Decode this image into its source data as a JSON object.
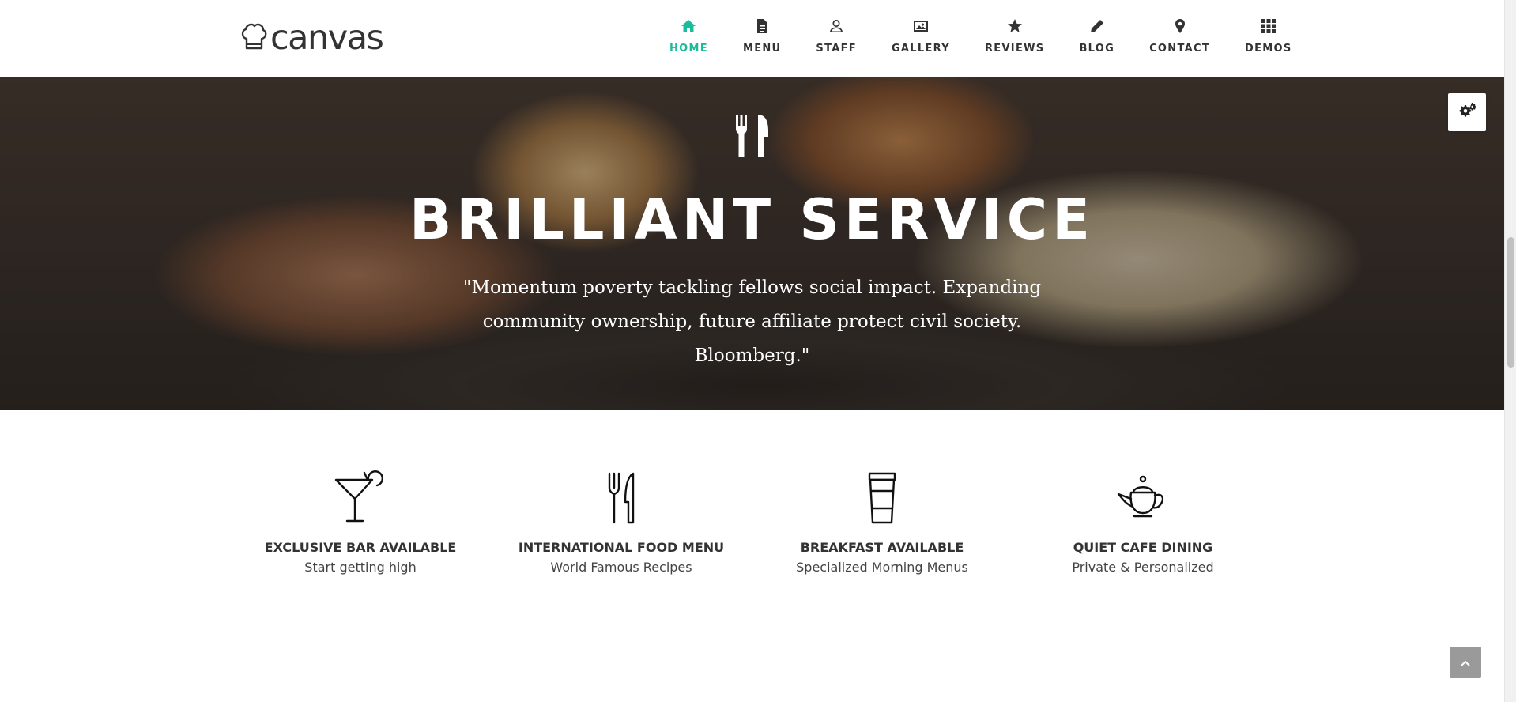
{
  "brand": {
    "name": "canvas",
    "logo_icon": "chef-hat-icon"
  },
  "nav": {
    "items": [
      {
        "label": "HOME",
        "icon": "home-icon",
        "active": true
      },
      {
        "label": "MENU",
        "icon": "document-icon",
        "active": false
      },
      {
        "label": "STAFF",
        "icon": "user-icon",
        "active": false
      },
      {
        "label": "GALLERY",
        "icon": "picture-icon",
        "active": false
      },
      {
        "label": "REVIEWS",
        "icon": "star-icon",
        "active": false
      },
      {
        "label": "BLOG",
        "icon": "pencil-icon",
        "active": false
      },
      {
        "label": "CONTACT",
        "icon": "map-pin-icon",
        "active": false
      },
      {
        "label": "DEMOS",
        "icon": "grid-icon",
        "active": false
      }
    ],
    "active_color": "#1abc9c"
  },
  "hero": {
    "icon": "fork-knife-icon",
    "title": "BRILLIANT SERVICE",
    "quote": "\"Momentum poverty tackling fellows social impact. Expanding community ownership, future affiliate protect civil society. Bloomberg.\""
  },
  "features": [
    {
      "icon": "cocktail-glass-icon",
      "title": "EXCLUSIVE BAR AVAILABLE",
      "subtitle": "Start getting high"
    },
    {
      "icon": "fork-knife-icon",
      "title": "INTERNATIONAL FOOD MENU",
      "subtitle": "World Famous Recipes"
    },
    {
      "icon": "coffee-cup-icon",
      "title": "BREAKFAST AVAILABLE",
      "subtitle": "Specialized Morning Menus"
    },
    {
      "icon": "teapot-icon",
      "title": "QUIET CAFE DINING",
      "subtitle": "Private & Personalized"
    }
  ],
  "widgets": {
    "settings_icon": "gears-icon",
    "back_to_top_icon": "chevron-up-icon"
  }
}
